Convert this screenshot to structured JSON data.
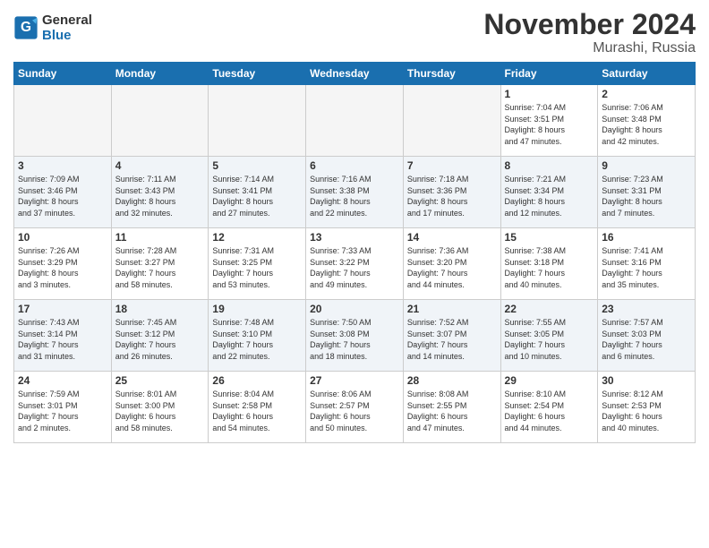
{
  "header": {
    "logo_line1": "General",
    "logo_line2": "Blue",
    "month": "November 2024",
    "location": "Murashi, Russia"
  },
  "days_of_week": [
    "Sunday",
    "Monday",
    "Tuesday",
    "Wednesday",
    "Thursday",
    "Friday",
    "Saturday"
  ],
  "weeks": [
    [
      {
        "day": "",
        "info": ""
      },
      {
        "day": "",
        "info": ""
      },
      {
        "day": "",
        "info": ""
      },
      {
        "day": "",
        "info": ""
      },
      {
        "day": "",
        "info": ""
      },
      {
        "day": "1",
        "info": "Sunrise: 7:04 AM\nSunset: 3:51 PM\nDaylight: 8 hours\nand 47 minutes."
      },
      {
        "day": "2",
        "info": "Sunrise: 7:06 AM\nSunset: 3:48 PM\nDaylight: 8 hours\nand 42 minutes."
      }
    ],
    [
      {
        "day": "3",
        "info": "Sunrise: 7:09 AM\nSunset: 3:46 PM\nDaylight: 8 hours\nand 37 minutes."
      },
      {
        "day": "4",
        "info": "Sunrise: 7:11 AM\nSunset: 3:43 PM\nDaylight: 8 hours\nand 32 minutes."
      },
      {
        "day": "5",
        "info": "Sunrise: 7:14 AM\nSunset: 3:41 PM\nDaylight: 8 hours\nand 27 minutes."
      },
      {
        "day": "6",
        "info": "Sunrise: 7:16 AM\nSunset: 3:38 PM\nDaylight: 8 hours\nand 22 minutes."
      },
      {
        "day": "7",
        "info": "Sunrise: 7:18 AM\nSunset: 3:36 PM\nDaylight: 8 hours\nand 17 minutes."
      },
      {
        "day": "8",
        "info": "Sunrise: 7:21 AM\nSunset: 3:34 PM\nDaylight: 8 hours\nand 12 minutes."
      },
      {
        "day": "9",
        "info": "Sunrise: 7:23 AM\nSunset: 3:31 PM\nDaylight: 8 hours\nand 7 minutes."
      }
    ],
    [
      {
        "day": "10",
        "info": "Sunrise: 7:26 AM\nSunset: 3:29 PM\nDaylight: 8 hours\nand 3 minutes."
      },
      {
        "day": "11",
        "info": "Sunrise: 7:28 AM\nSunset: 3:27 PM\nDaylight: 7 hours\nand 58 minutes."
      },
      {
        "day": "12",
        "info": "Sunrise: 7:31 AM\nSunset: 3:25 PM\nDaylight: 7 hours\nand 53 minutes."
      },
      {
        "day": "13",
        "info": "Sunrise: 7:33 AM\nSunset: 3:22 PM\nDaylight: 7 hours\nand 49 minutes."
      },
      {
        "day": "14",
        "info": "Sunrise: 7:36 AM\nSunset: 3:20 PM\nDaylight: 7 hours\nand 44 minutes."
      },
      {
        "day": "15",
        "info": "Sunrise: 7:38 AM\nSunset: 3:18 PM\nDaylight: 7 hours\nand 40 minutes."
      },
      {
        "day": "16",
        "info": "Sunrise: 7:41 AM\nSunset: 3:16 PM\nDaylight: 7 hours\nand 35 minutes."
      }
    ],
    [
      {
        "day": "17",
        "info": "Sunrise: 7:43 AM\nSunset: 3:14 PM\nDaylight: 7 hours\nand 31 minutes."
      },
      {
        "day": "18",
        "info": "Sunrise: 7:45 AM\nSunset: 3:12 PM\nDaylight: 7 hours\nand 26 minutes."
      },
      {
        "day": "19",
        "info": "Sunrise: 7:48 AM\nSunset: 3:10 PM\nDaylight: 7 hours\nand 22 minutes."
      },
      {
        "day": "20",
        "info": "Sunrise: 7:50 AM\nSunset: 3:08 PM\nDaylight: 7 hours\nand 18 minutes."
      },
      {
        "day": "21",
        "info": "Sunrise: 7:52 AM\nSunset: 3:07 PM\nDaylight: 7 hours\nand 14 minutes."
      },
      {
        "day": "22",
        "info": "Sunrise: 7:55 AM\nSunset: 3:05 PM\nDaylight: 7 hours\nand 10 minutes."
      },
      {
        "day": "23",
        "info": "Sunrise: 7:57 AM\nSunset: 3:03 PM\nDaylight: 7 hours\nand 6 minutes."
      }
    ],
    [
      {
        "day": "24",
        "info": "Sunrise: 7:59 AM\nSunset: 3:01 PM\nDaylight: 7 hours\nand 2 minutes."
      },
      {
        "day": "25",
        "info": "Sunrise: 8:01 AM\nSunset: 3:00 PM\nDaylight: 6 hours\nand 58 minutes."
      },
      {
        "day": "26",
        "info": "Sunrise: 8:04 AM\nSunset: 2:58 PM\nDaylight: 6 hours\nand 54 minutes."
      },
      {
        "day": "27",
        "info": "Sunrise: 8:06 AM\nSunset: 2:57 PM\nDaylight: 6 hours\nand 50 minutes."
      },
      {
        "day": "28",
        "info": "Sunrise: 8:08 AM\nSunset: 2:55 PM\nDaylight: 6 hours\nand 47 minutes."
      },
      {
        "day": "29",
        "info": "Sunrise: 8:10 AM\nSunset: 2:54 PM\nDaylight: 6 hours\nand 44 minutes."
      },
      {
        "day": "30",
        "info": "Sunrise: 8:12 AM\nSunset: 2:53 PM\nDaylight: 6 hours\nand 40 minutes."
      }
    ]
  ]
}
